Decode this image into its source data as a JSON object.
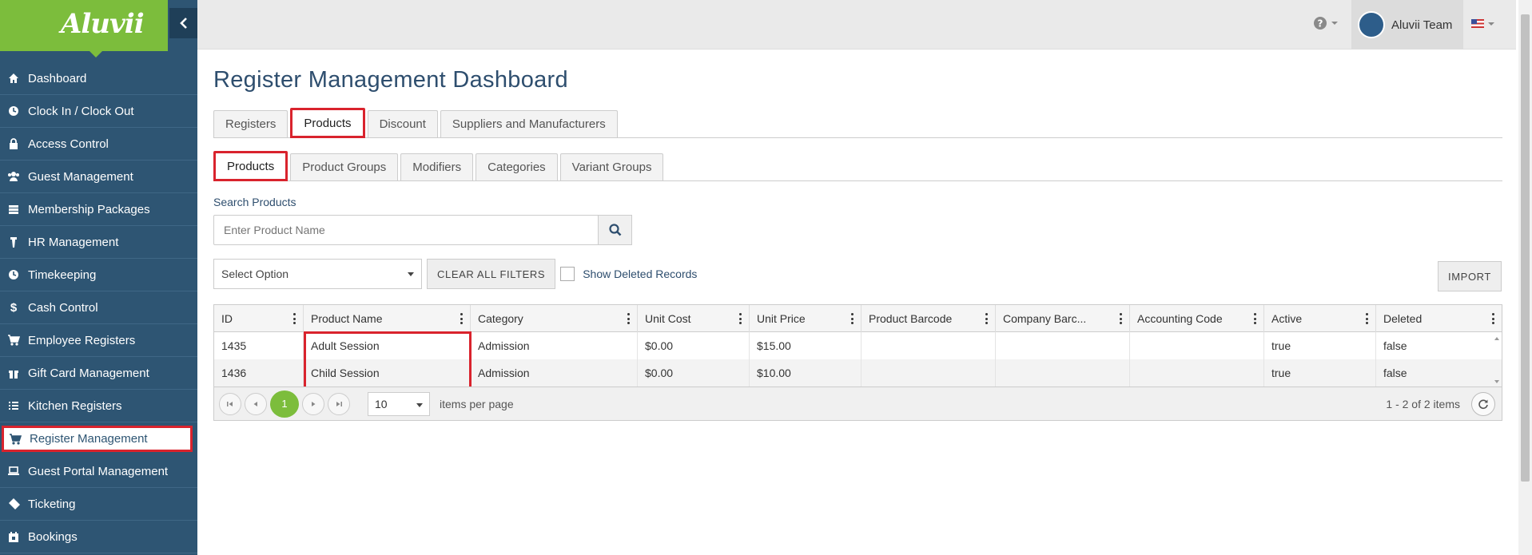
{
  "app": {
    "logo": "Aluvii"
  },
  "sidebar": {
    "items": [
      {
        "label": "Dashboard",
        "icon": "home-icon"
      },
      {
        "label": "Clock In / Clock Out",
        "icon": "clock-icon"
      },
      {
        "label": "Access Control",
        "icon": "lock-icon"
      },
      {
        "label": "Guest Management",
        "icon": "users-icon"
      },
      {
        "label": "Membership Packages",
        "icon": "card-icon"
      },
      {
        "label": "HR Management",
        "icon": "person-icon"
      },
      {
        "label": "Timekeeping",
        "icon": "clock-icon"
      },
      {
        "label": "Cash Control",
        "icon": "dollar-icon"
      },
      {
        "label": "Employee Registers",
        "icon": "cart-icon"
      },
      {
        "label": "Gift Card Management",
        "icon": "gift-icon"
      },
      {
        "label": "Kitchen Registers",
        "icon": "list-icon"
      },
      {
        "label": "Register Management",
        "icon": "cart-icon"
      },
      {
        "label": "Guest Portal Management",
        "icon": "laptop-icon"
      },
      {
        "label": "Ticketing",
        "icon": "ticket-icon"
      },
      {
        "label": "Bookings",
        "icon": "calendar-icon"
      }
    ]
  },
  "topbar": {
    "user_name": "Aluvii Team"
  },
  "main": {
    "title": "Register Management Dashboard",
    "tabs": [
      "Registers",
      "Products",
      "Discount",
      "Suppliers and Manufacturers"
    ],
    "subtabs": [
      "Products",
      "Product Groups",
      "Modifiers",
      "Categories",
      "Variant Groups"
    ],
    "search": {
      "label": "Search Products",
      "placeholder": "Enter Product Name"
    },
    "filter": {
      "select_value": "Select Option",
      "clear_label": "CLEAR ALL FILTERS",
      "show_deleted_label": "Show Deleted Records",
      "import_label": "IMPORT"
    }
  },
  "grid": {
    "columns": [
      "ID",
      "Product Name",
      "Category",
      "Unit Cost",
      "Unit Price",
      "Product Barcode",
      "Company Barc...",
      "Accounting Code",
      "Active",
      "Deleted"
    ],
    "rows": [
      [
        "1435",
        "Adult Session",
        "Admission",
        "$0.00",
        "$15.00",
        "",
        "",
        "",
        "true",
        "false"
      ],
      [
        "1436",
        "Child Session",
        "Admission",
        "$0.00",
        "$10.00",
        "",
        "",
        "",
        "true",
        "false"
      ]
    ],
    "pager": {
      "current_page": "1",
      "page_size": "10",
      "per_page_label": "items per page",
      "info": "1 - 2 of 2 items"
    }
  }
}
